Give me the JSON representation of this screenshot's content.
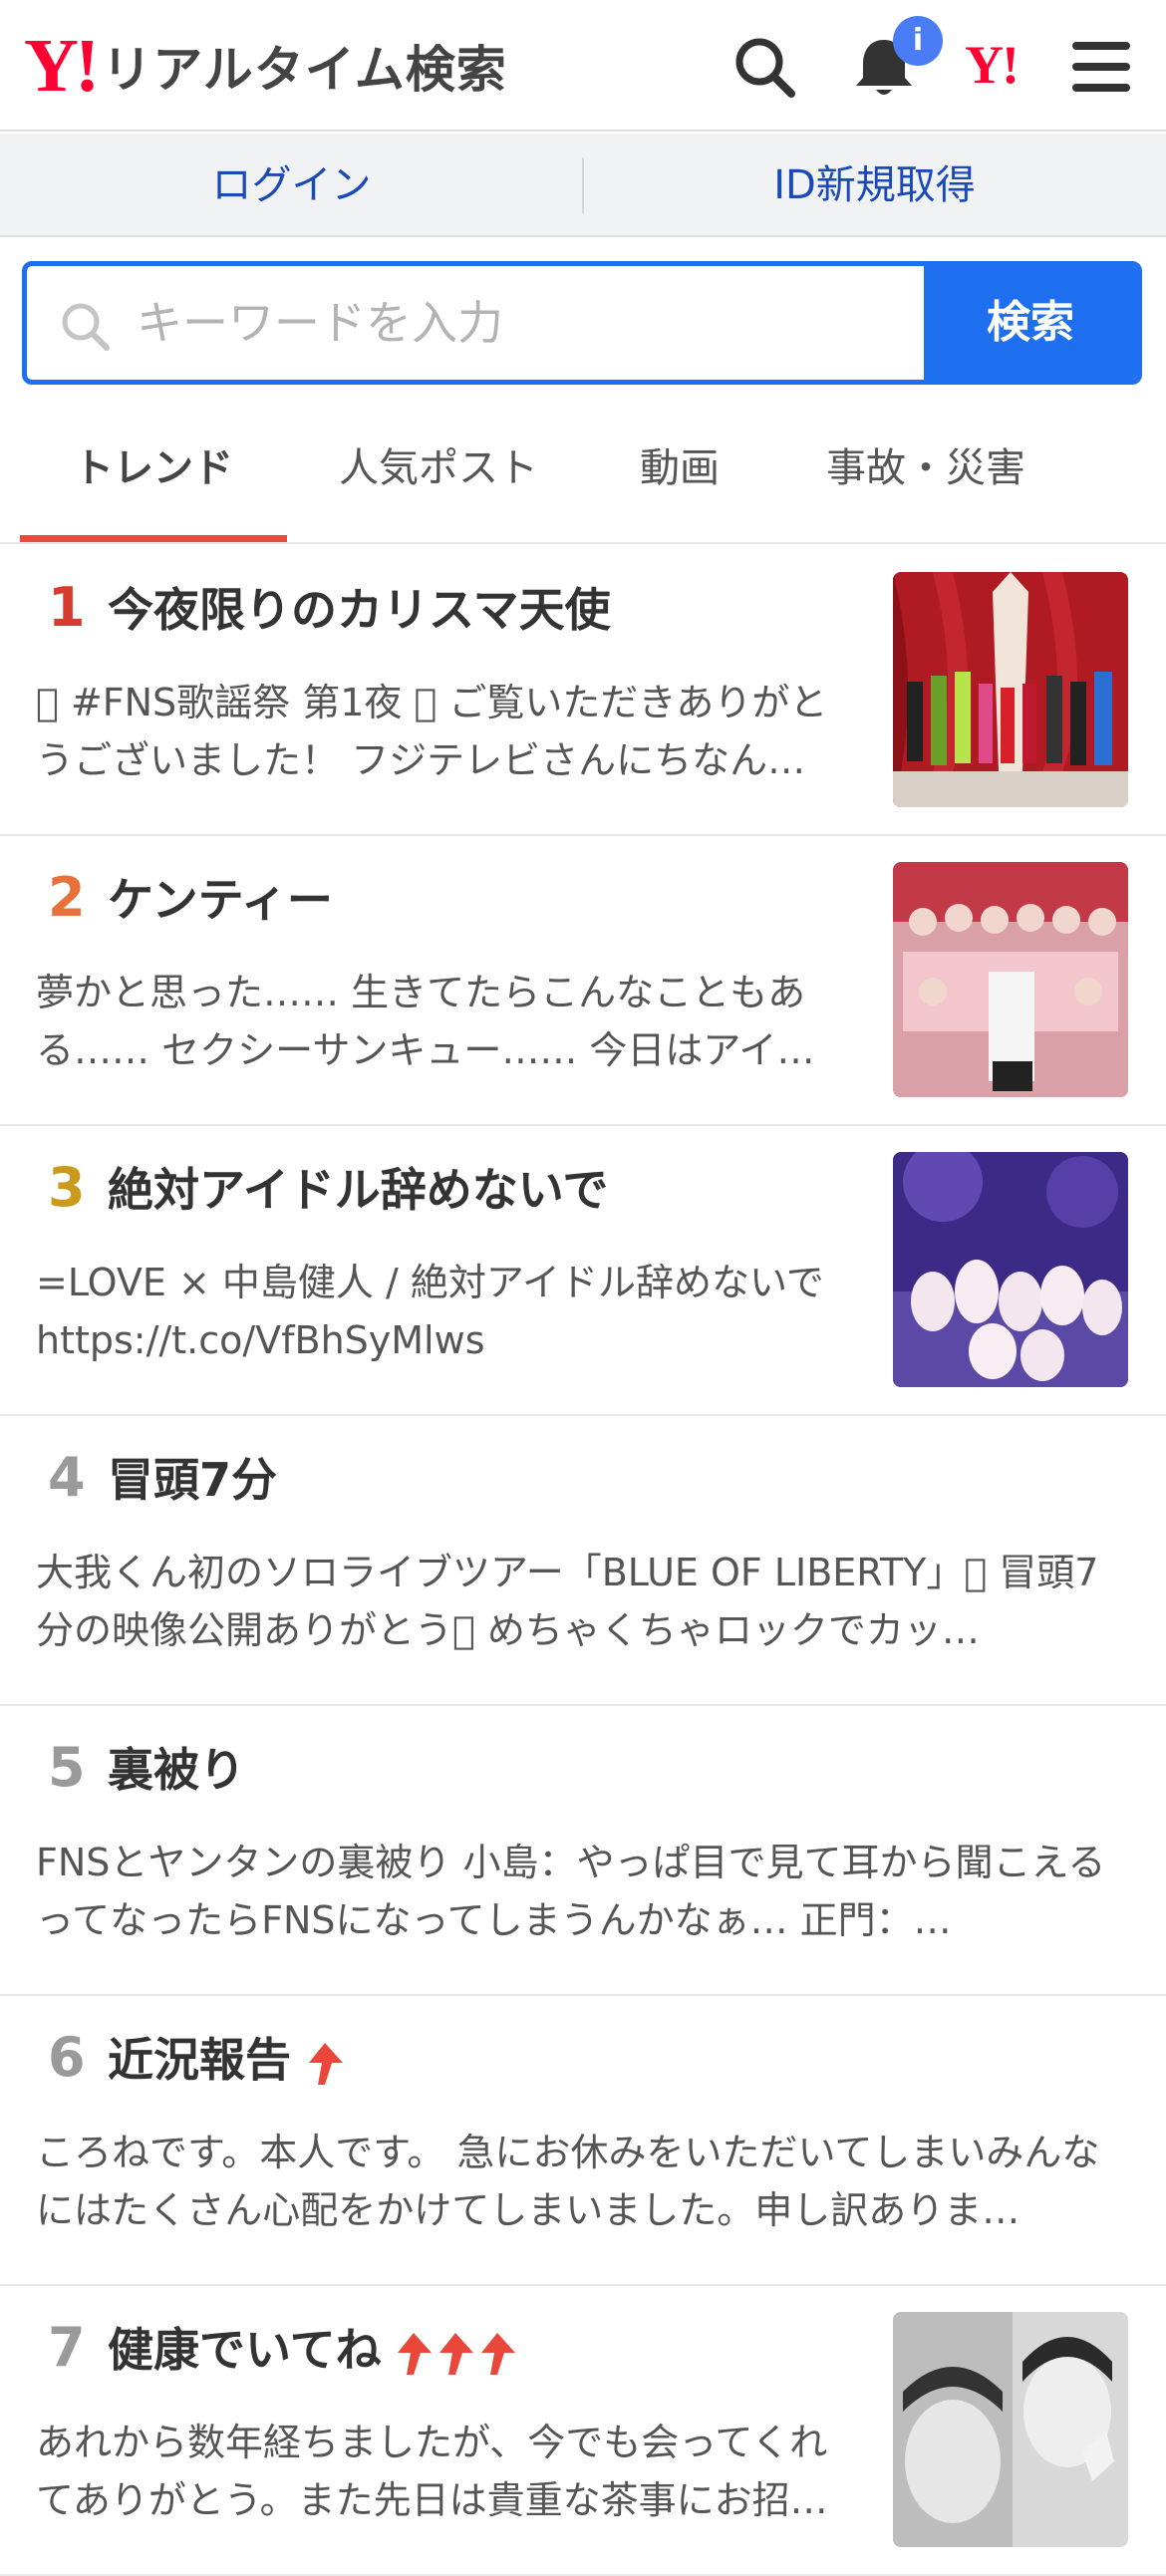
{
  "header": {
    "logo_mark": "Y!",
    "logo_text": "リアルタイム検索",
    "notification_badge": "i",
    "yahoo_mark": "Y!"
  },
  "auth": {
    "login_label": "ログイン",
    "signup_label": "ID新規取得"
  },
  "search": {
    "placeholder": "キーワードを入力",
    "button_label": "検索"
  },
  "tabs": [
    {
      "label": "トレンド",
      "active": true
    },
    {
      "label": "人気ポスト",
      "active": false
    },
    {
      "label": "動画",
      "active": false
    },
    {
      "label": "事故・災害",
      "active": false
    }
  ],
  "colors": {
    "accent_blue": "#1e6fef",
    "brand_red": "#ff0033",
    "tab_underline": "#e84a3d",
    "rising_arrow": "#e8473a"
  },
  "trends": [
    {
      "rank": "1",
      "title": "今夜限りのカリスマ天使",
      "desc": "􀀀 #FNS歌謡祭 第1夜 􀀀 ご覧いただきありがとうございました！ フジテレビさんにちなん…",
      "has_image": true,
      "arrows": 0
    },
    {
      "rank": "2",
      "title": "ケンティー",
      "desc": "夢かと思った…… 生きてたらこんなこともある…… セクシーサンキュー…… 今日はアイ…",
      "has_image": true,
      "arrows": 0
    },
    {
      "rank": "3",
      "title": "絶対アイドル辞めないで",
      "desc": "=LOVE × 中島健人 / 絶対アイドル辞めないで https://t.co/VfBhSyMlws",
      "has_image": true,
      "arrows": 0
    },
    {
      "rank": "4",
      "title": "冒頭7分",
      "desc": "大我くん初のソロライブツアー「BLUE OF LIBERTY」􀀀 冒頭7分の映像公開ありがとう􀀀 めちゃくちゃロックでカッ…",
      "has_image": false,
      "arrows": 0
    },
    {
      "rank": "5",
      "title": "裏被り",
      "desc": "FNSとヤンタンの裏被り 小島：やっぱ目で見て耳から聞こえるってなったらFNSになってしまうんかなぁ… 正門：…",
      "has_image": false,
      "arrows": 0
    },
    {
      "rank": "6",
      "title": "近況報告",
      "desc": "ころねです。本人です。 急にお休みをいただいてしまいみんなにはたくさん心配をかけてしまいました。申し訳ありま…",
      "has_image": false,
      "arrows": 1
    },
    {
      "rank": "7",
      "title": "健康でいてね",
      "desc": "あれから数年経ちましたが、今でも会ってくれてありがとう。また先日は貴重な茶事にお招…",
      "has_image": true,
      "arrows": 3
    }
  ]
}
